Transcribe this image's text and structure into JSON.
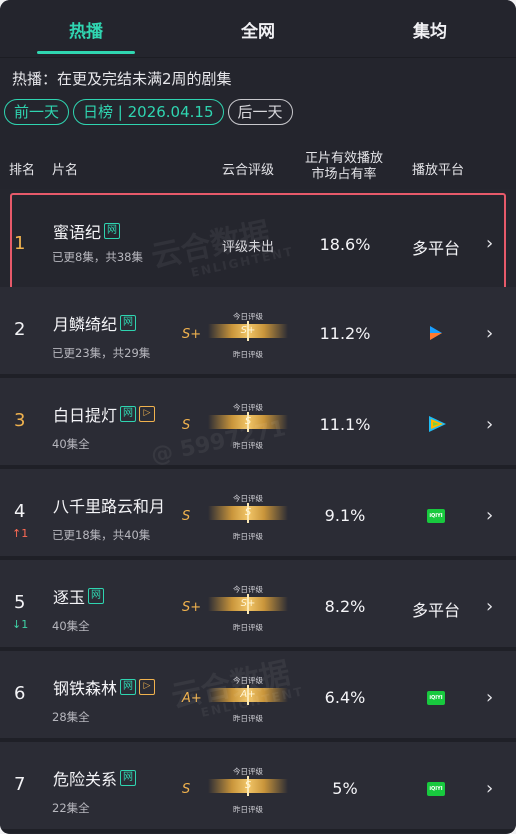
{
  "tabs": [
    {
      "label": "热播",
      "active": true
    },
    {
      "label": "全网",
      "active": false
    },
    {
      "label": "集均",
      "active": false
    }
  ],
  "description": "热播：在更及完结未满2周的剧集",
  "date_nav": {
    "prev": "前一天",
    "current": "日榜 | 2026.04.15",
    "next": "后一天"
  },
  "columns": {
    "rank": "排名",
    "name": "片名",
    "rating": "云合评级",
    "share": "正片有效播放\n市场占有率",
    "platform": "播放平台"
  },
  "rating_labels": {
    "today": "今日评级",
    "yesterday": "昨日评级"
  },
  "watermark": {
    "text1": "云合数据",
    "text2": "ENLIGHTENT",
    "text3": "@ 5997271"
  },
  "rows": [
    {
      "rank": "1",
      "title": "蜜语纪",
      "badges": [
        "网"
      ],
      "sub": "已更8集，共38集",
      "rating_text": "评级未出",
      "share": "18.6%",
      "platform_text": "多平台",
      "change": ""
    },
    {
      "rank": "2",
      "title": "月鳞绮纪",
      "badges": [
        "网"
      ],
      "sub": "已更23集，共29集",
      "grade": "S+",
      "bar_value": "S+",
      "share": "11.2%",
      "platform_icon": "youku-icon",
      "change": ""
    },
    {
      "rank": "3",
      "title": "白日提灯",
      "badges": [
        "网",
        "▷"
      ],
      "sub": "40集全",
      "grade": "S",
      "bar_value": "S",
      "share": "11.1%",
      "platform_icon": "tencent-video-icon",
      "change": ""
    },
    {
      "rank": "4",
      "title": "八千里路云和月",
      "badges": [],
      "sub": "已更18集，共40集",
      "grade": "S",
      "bar_value": "S",
      "share": "9.1%",
      "platform_icon": "iqiyi-icon",
      "change": "↑1"
    },
    {
      "rank": "5",
      "title": "逐玉",
      "badges": [
        "网"
      ],
      "sub": "40集全",
      "grade": "S+",
      "bar_value": "S+",
      "share": "8.2%",
      "platform_text": "多平台",
      "change": "↓1"
    },
    {
      "rank": "6",
      "title": "钢铁森林",
      "badges": [
        "网",
        "▷"
      ],
      "sub": "28集全",
      "grade": "A+",
      "bar_value": "A+",
      "share": "6.4%",
      "platform_icon": "iqiyi-icon",
      "change": ""
    },
    {
      "rank": "7",
      "title": "危险关系",
      "badges": [
        "网"
      ],
      "sub": "22集全",
      "grade": "S",
      "bar_value": "S",
      "share": "5%",
      "platform_icon": "iqiyi-icon",
      "change": ""
    }
  ],
  "iqiyi_label": "iQIYI",
  "chevron": "›",
  "colors": {
    "accent": "#30d6b1",
    "highlight": "#e75a6a",
    "gold": "#f0b24e",
    "bg": "#24252d"
  }
}
